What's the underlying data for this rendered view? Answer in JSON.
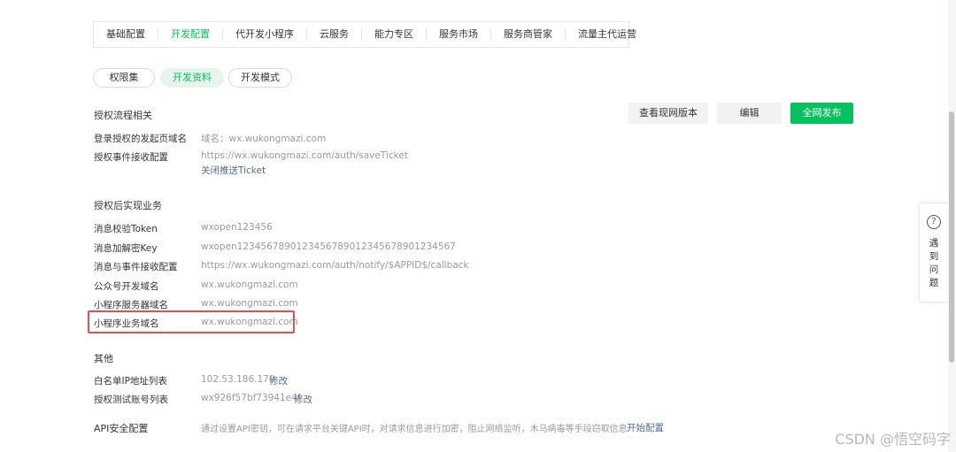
{
  "top_tabs": [
    "基础配置",
    "开发配置",
    "代开发小程序",
    "云服务",
    "能力专区",
    "服务市场",
    "服务商管家",
    "流量主代运营"
  ],
  "sub_tabs": [
    "权限集",
    "开发资料",
    "开发模式"
  ],
  "actions": {
    "view_online": "查看现网版本",
    "edit": "编辑",
    "publish": "全网发布"
  },
  "sections": {
    "auth_flow": {
      "title": "授权流程相关",
      "rows": [
        {
          "label": "登录授权的发起页域名",
          "value": "域名：wx.wukongmazi.com"
        },
        {
          "label": "授权事件接收配置",
          "value": "https://wx.wukongmazi.com/auth/saveTicket",
          "link": "关闭推送Ticket"
        }
      ]
    },
    "post_auth": {
      "title": "授权后实现业务",
      "rows": [
        {
          "label": "消息校验Token",
          "value": "wxopen123456"
        },
        {
          "label": "消息加解密Key",
          "value": "wxopen1234567890123456789012345678901234567"
        },
        {
          "label": "消息与事件接收配置",
          "value": "https://wx.wukongmazi.com/auth/notify/$APPID$/callback"
        },
        {
          "label": "公众号开发域名",
          "value": "wx.wukongmazi.com"
        },
        {
          "label": "小程序服务器域名",
          "value": "wx.wukongmazi.com"
        },
        {
          "label": "小程序业务域名",
          "value": "wx.wukongmazi.com"
        }
      ]
    },
    "other": {
      "title": "其他",
      "rows": [
        {
          "label": "白名单IP地址列表",
          "value": "102.53.186.179",
          "link": "修改"
        },
        {
          "label": "授权测试账号列表",
          "value": "wx926f57bf73941e4f",
          "link": "修改"
        }
      ]
    },
    "api_security": {
      "label": "API安全配置",
      "value": "通过设置API密钥，可在请求平台关键API时，对请求信息进行加密，阻止网络监听，木马病毒等手段窃取信息",
      "link": "开始配置"
    }
  },
  "help": {
    "icon": "question-circle-icon",
    "symbol": "?",
    "text": "遇到问题"
  },
  "watermark": "CSDN @悟空码字",
  "colors": {
    "accent": "#07c160",
    "link": "#576b95",
    "highlight": "#e0524e"
  }
}
